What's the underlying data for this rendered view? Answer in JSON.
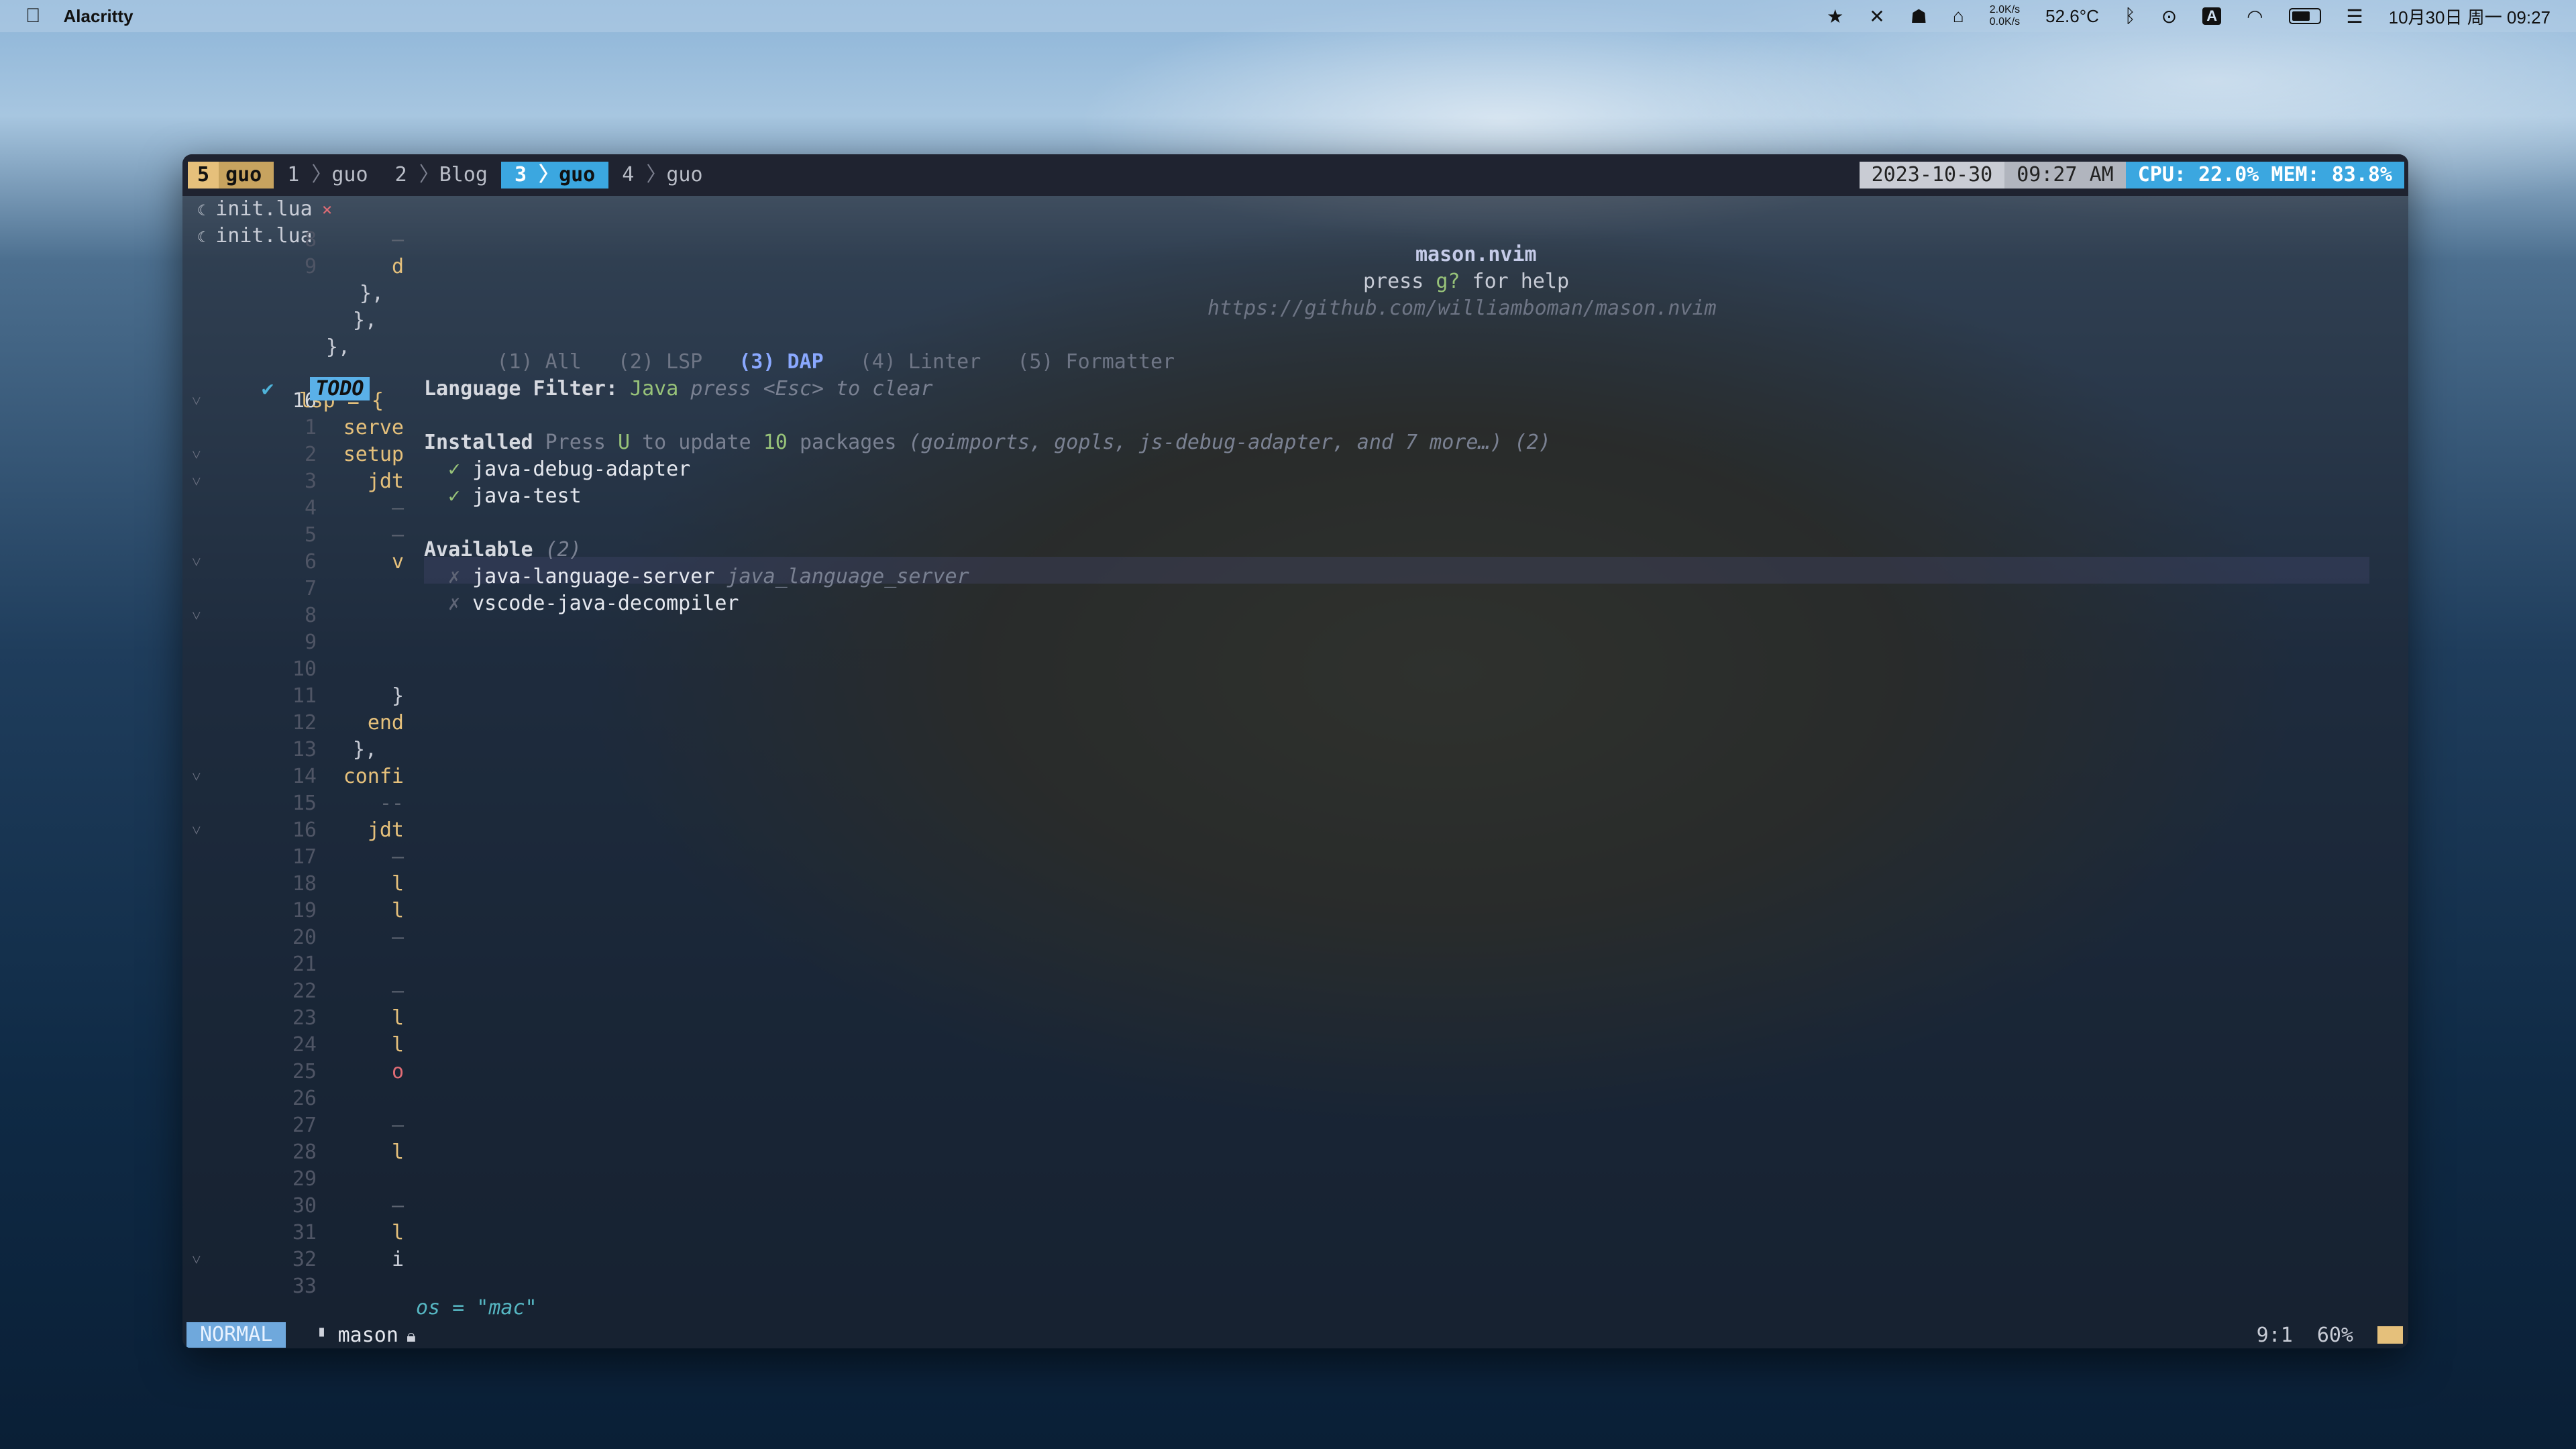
{
  "menubar": {
    "app_name": "Alacritty",
    "net_up": "2.0K/s",
    "net_down": "0.0K/s",
    "temperature": "52.6°C",
    "input_method": "A",
    "datetime": "10月30日 周一 09:27"
  },
  "tmux": {
    "session_number": "5",
    "session_name": "guo",
    "windows": [
      {
        "num": "1",
        "name": "guo"
      },
      {
        "num": "2",
        "name": "Blog"
      },
      {
        "num": "3",
        "name": "guo"
      },
      {
        "num": "4",
        "name": "guo"
      }
    ],
    "date": "2023-10-30",
    "time": "09:27 AM",
    "sysinfo": "CPU: 22.0% MEM: 83.8%"
  },
  "buffers": [
    {
      "name": "init.lua",
      "close": "×"
    },
    {
      "name": "init.lua"
    }
  ],
  "mason": {
    "title": "mason.nvim",
    "help_prefix": "press ",
    "help_key": "g?",
    "help_suffix": " for help",
    "url": "https://github.com/williamboman/mason.nvim",
    "tabs": [
      "(1) All",
      "(2) LSP",
      "(3) DAP",
      "(4) Linter",
      "(5) Formatter"
    ],
    "active_tab": "(3) DAP",
    "filter_label": "Language Filter:",
    "filter_value": "Java",
    "filter_hint": "press <Esc> to clear",
    "installed_label": "Installed",
    "update_text_1": "Press",
    "update_key": "U",
    "update_text_2": "to update",
    "update_count": "10",
    "update_text_3": "packages",
    "update_list": "(goimports, gopls, js-debug-adapter, and 7 more…) (2)",
    "installed": [
      "java-debug-adapter",
      "java-test"
    ],
    "available_label": "Available",
    "available_count": "(2)",
    "available": [
      {
        "name": "java-language-server",
        "alias": "java_language_server"
      },
      {
        "name": "vscode-java-decompiler",
        "alias": ""
      }
    ]
  },
  "editor": {
    "todo_tag": "TODO",
    "last_line_text": "os = \"mac\"",
    "lines": [
      {
        "num": "8",
        "code": "–"
      },
      {
        "num": "9",
        "code": "d"
      },
      {
        "num": "",
        "code": "},"
      },
      {
        "num": "",
        "code": "},"
      },
      {
        "num": "",
        "code": "},"
      },
      {
        "num": "",
        "code": ""
      },
      {
        "num": "16",
        "code": "lsp = {",
        "current": true,
        "fold": "˅"
      },
      {
        "num": "1",
        "code": "serve"
      },
      {
        "num": "2",
        "code": "setup",
        "fold": "˅"
      },
      {
        "num": "3",
        "code": "jdt",
        "fold": "˅"
      },
      {
        "num": "4",
        "code": "–"
      },
      {
        "num": "5",
        "code": "–"
      },
      {
        "num": "6",
        "code": "v",
        "fold": "˅"
      },
      {
        "num": "7",
        "code": ""
      },
      {
        "num": "8",
        "code": "",
        "fold": "˅"
      },
      {
        "num": "9",
        "code": ""
      },
      {
        "num": "10",
        "code": ""
      },
      {
        "num": "11",
        "code": "}"
      },
      {
        "num": "12",
        "code": "end"
      },
      {
        "num": "13",
        "code": "},"
      },
      {
        "num": "14",
        "code": "confi",
        "fold": "˅"
      },
      {
        "num": "15",
        "code": "--"
      },
      {
        "num": "16",
        "code": "jdt",
        "fold": "˅"
      },
      {
        "num": "17",
        "code": "–"
      },
      {
        "num": "18",
        "code": "l"
      },
      {
        "num": "19",
        "code": "l"
      },
      {
        "num": "20",
        "code": "–"
      },
      {
        "num": "21",
        "code": ""
      },
      {
        "num": "22",
        "code": "–"
      },
      {
        "num": "23",
        "code": "l"
      },
      {
        "num": "24",
        "code": "l"
      },
      {
        "num": "25",
        "code": "o"
      },
      {
        "num": "26",
        "code": ""
      },
      {
        "num": "27",
        "code": "–"
      },
      {
        "num": "28",
        "code": "l"
      },
      {
        "num": "29",
        "code": ""
      },
      {
        "num": "30",
        "code": "–"
      },
      {
        "num": "31",
        "code": "l"
      },
      {
        "num": "32",
        "code": "i",
        "fold": "˅"
      },
      {
        "num": "33",
        "code": ""
      }
    ]
  },
  "statusline": {
    "mode": "NORMAL",
    "filename": "mason",
    "position": "9:1",
    "percent": "60%"
  }
}
